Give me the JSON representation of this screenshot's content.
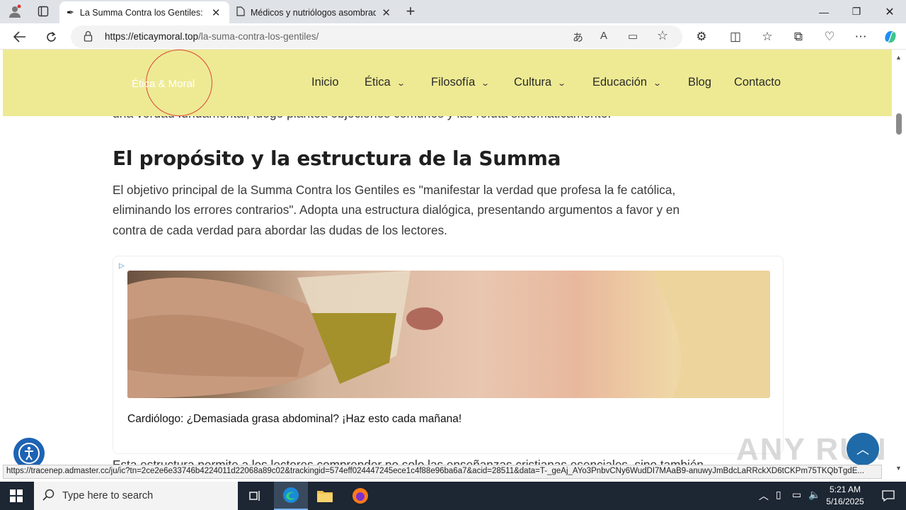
{
  "browser": {
    "tabs": [
      {
        "title": "La Summa Contra los Gentiles: Un",
        "active": true
      },
      {
        "title": "Médicos y nutriólogos asombrad",
        "active": false
      }
    ],
    "url_domain": "https://eticaymoral.top",
    "url_path": "/la-suma-contra-los-gentiles/"
  },
  "site": {
    "logo": "Ética & Moral",
    "nav": [
      "Inicio",
      "Ética",
      "Filosofía",
      "Cultura",
      "Educación",
      "Blog",
      "Contacto"
    ],
    "nav_dropdown": [
      false,
      true,
      true,
      true,
      true,
      false,
      false
    ]
  },
  "article": {
    "clipped_line": "una verdad fundamental, luego plantea objeciones comunes y las refuta sistemáticamente.",
    "heading": "El propósito y la estructura de la Summa",
    "paragraph_lines": [
      "El objetivo principal de la Summa Contra los Gentiles es \"manifestar la verdad que profesa la fe católica,",
      "eliminando los errores contrarios\". Adopta una estructura dialógica, presentando argumentos a favor y en",
      "contra de cada verdad para abordar las dudas de los lectores."
    ],
    "bottom_line": "Esta estructura permite a los lectores comprender no solo las enseñanzas cristianas esenciales, sino también"
  },
  "ad": {
    "caption": "Cardiólogo: ¿Demasiada grasa abdominal? ¡Haz esto cada mañana!"
  },
  "status_link": "https://tracenep.admaster.cc/ju/ic?tn=2ce2e6e33746b4224011d22068a89c02&trackingid=574eff024447245ece1c4f88e96ba6a7&acid=28511&data=T-_geAj_AYo3PnbvCNy6WudDI7MAaB9-anuwyJmBdcLaRRckXD6tCKPm75TKQbTgdE...",
  "taskbar": {
    "search_placeholder": "Type here to search",
    "time": "5:21 AM",
    "date": "5/16/2025"
  },
  "watermark": "ANY RUN"
}
